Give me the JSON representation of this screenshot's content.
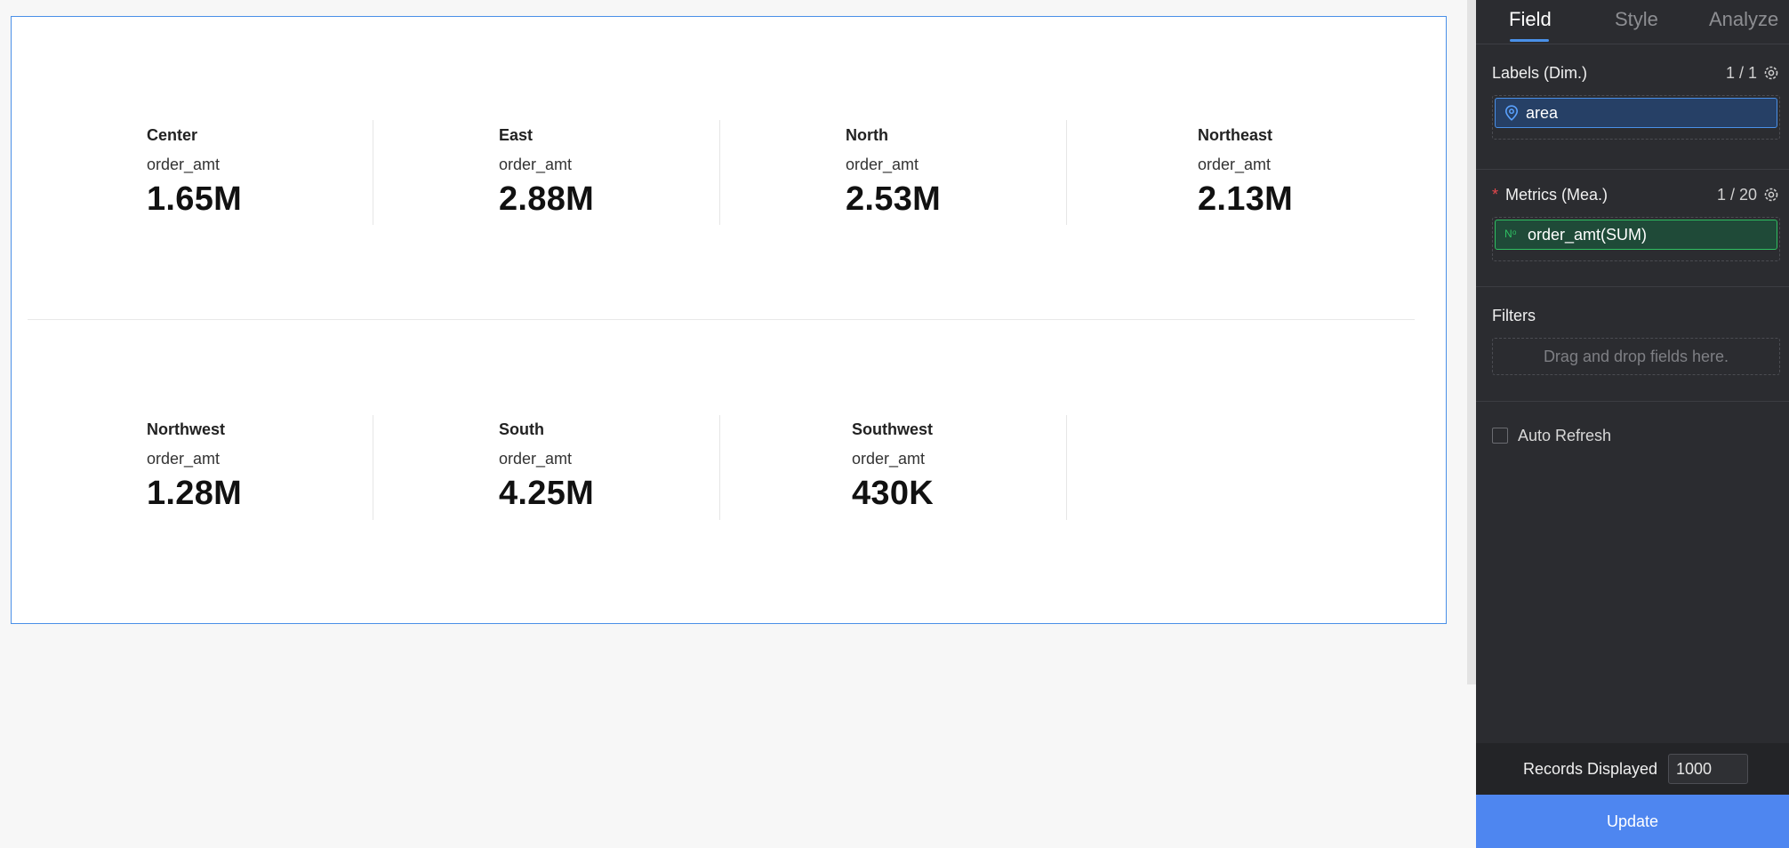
{
  "kpis": [
    {
      "area": "Center",
      "metric": "order_amt",
      "value": "1.65M"
    },
    {
      "area": "East",
      "metric": "order_amt",
      "value": "2.88M"
    },
    {
      "area": "North",
      "metric": "order_amt",
      "value": "2.53M"
    },
    {
      "area": "Northeast",
      "metric": "order_amt",
      "value": "2.13M"
    },
    {
      "area": "Northwest",
      "metric": "order_amt",
      "value": "1.28M"
    },
    {
      "area": "South",
      "metric": "order_amt",
      "value": "4.25M"
    },
    {
      "area": "Southwest",
      "metric": "order_amt",
      "value": "430K"
    }
  ],
  "panel": {
    "tabs": [
      {
        "label": "Field",
        "active": true
      },
      {
        "label": "Style",
        "active": false
      },
      {
        "label": "Analyze",
        "active": false
      }
    ],
    "labels_section": {
      "title": "Labels (Dim.)",
      "count": "1 / 1",
      "field": "area",
      "icon": "location-pin-icon"
    },
    "metrics_section": {
      "required_mark": "*",
      "title": "Metrics (Mea.)",
      "count": "1 / 20",
      "field": "order_amt(SUM)",
      "icon": "number-icon"
    },
    "filters_section": {
      "title": "Filters",
      "placeholder": "Drag and drop fields here."
    },
    "auto_refresh": {
      "label": "Auto Refresh",
      "checked": false
    },
    "records": {
      "label": "Records Displayed",
      "value": "1000"
    },
    "update_label": "Update"
  },
  "colors": {
    "accent": "#4a90e8",
    "dimension_pill": "#264066",
    "measure_pill": "#1f4a38",
    "measure_border": "#2fc062",
    "update_button": "#4e86f0",
    "required": "#e5484d"
  }
}
